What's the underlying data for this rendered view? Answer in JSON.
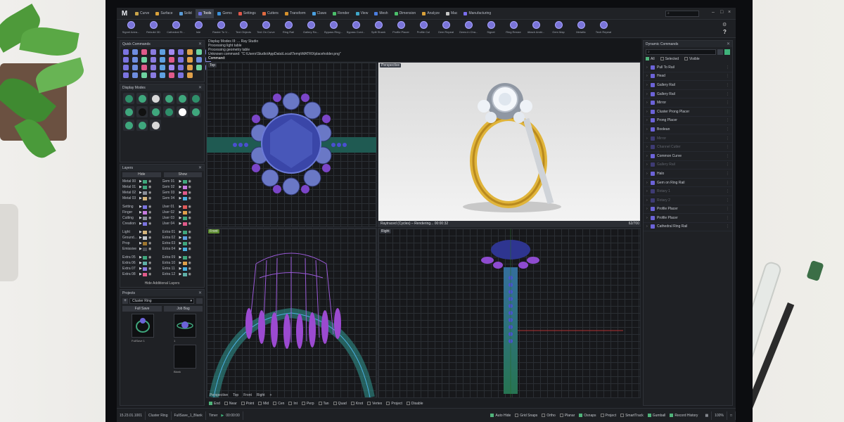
{
  "app": {
    "logo": "M",
    "menu_tabs": [
      {
        "label": "Curve",
        "color": "#c9a44a"
      },
      {
        "label": "Surface",
        "color": "#d9a13a"
      },
      {
        "label": "Solid",
        "color": "#5a9bd6"
      },
      {
        "label": "Tools",
        "color": "#6b6ee0",
        "active": true
      },
      {
        "label": "Gems",
        "color": "#3b8fd9"
      },
      {
        "label": "Settings",
        "color": "#e0584b"
      },
      {
        "label": "Cutters",
        "color": "#e06a40"
      },
      {
        "label": "Transform",
        "color": "#d6912c"
      },
      {
        "label": "Claws",
        "color": "#4aa0e0"
      },
      {
        "label": "Render",
        "color": "#4bbf6a"
      },
      {
        "label": "View",
        "color": "#3fa7c9"
      },
      {
        "label": "Mesh",
        "color": "#4b7ee0"
      },
      {
        "label": "Dimension",
        "color": "#4bbf6a"
      },
      {
        "label": "Analyze",
        "color": "#d9a13a"
      },
      {
        "label": "Mac",
        "color": "#c6c6c6"
      },
      {
        "label": "Manufacturing",
        "color": "#7b6ef0"
      }
    ],
    "search_placeholder": "⌕",
    "help_icon": "?",
    "ribbon": [
      "Signet Adva...",
      "Rebuild 3D",
      "Cathedral Ri...",
      "Isle",
      "Raster To V...",
      "Text Objects",
      "Text On Curve",
      "Ring Rail",
      "Gallery Ra...",
      "Bypass Ring...",
      "Bypass Curvi...",
      "Split Shank",
      "Profile Placer",
      "Profile Cut",
      "Gem Repeat",
      "Gems in Cha...",
      "Signet",
      "Ring Resize",
      "Attach Ambi...",
      "Gem Map",
      "Metallic",
      "Tech Repeat"
    ]
  },
  "quick_commands": {
    "title": "Quick Commands",
    "icon_colors": [
      "#7b74e0",
      "#6e8ee0",
      "#e05a8a",
      "#8a7be0",
      "#5fa0e0",
      "#a28af0",
      "#7b74e0",
      "#e0a04a",
      "#6ed3a0",
      "#8a8ae0",
      "#7b74e0",
      "#6e8ee0",
      "#6ed3a0",
      "#8a7be0",
      "#5fa0e0",
      "#e05a8a",
      "#7b74e0",
      "#e0a04a",
      "#6e8ee0",
      "#8a8ae0",
      "#7b74e0",
      "#6e8ee0",
      "#e05a8a",
      "#8a7be0",
      "#5fa0e0",
      "#a28af0",
      "#7b74e0",
      "#e0a04a",
      "#6ed3a0",
      "#8a8ae0",
      "#7b74e0",
      "#6e8ee0",
      "#6ed3a0",
      "#8a7be0",
      "#5fa0e0",
      "#e05a8a",
      "#7b74e0",
      "#e0a04a"
    ]
  },
  "display_modes": {
    "title": "Display Modes",
    "swatches": [
      "#2f8f6a",
      "#3fa77d",
      "#d8d8d8",
      "#3fa77d",
      "#3fa77d",
      "#2f8f6a",
      "#3fa77d",
      "#111",
      "#3fa77d",
      "#2f8f6a",
      "#ffffff",
      "#3fa77d",
      "#3fa77d",
      "#3fa77d",
      "#d8d8d8"
    ]
  },
  "layers": {
    "title": "Layers",
    "hide_label": "Hide",
    "show_label": "Show",
    "left": [
      [
        {
          "n": "Metal 00",
          "c": "#3fa77d"
        },
        {
          "n": "Metal 01",
          "c": "#3fa77d"
        },
        {
          "n": "Metal 02",
          "c": "#8a8f99"
        },
        {
          "n": "Metal 03",
          "c": "#d5b57c"
        }
      ],
      [
        {
          "n": "Setting",
          "c": "#7b74e0"
        },
        {
          "n": "Finger",
          "c": "#c77be0"
        },
        {
          "n": "Cutting",
          "c": "#8a8f99"
        },
        {
          "n": "Creation",
          "c": "#7b74e0"
        }
      ],
      [
        {
          "n": "Light",
          "c": "#d5b57c"
        },
        {
          "n": "Ground...",
          "c": "#c0c4ca"
        },
        {
          "n": "Prop",
          "c": "#a0772f"
        },
        {
          "n": "Emissive",
          "c": "#4a4d55"
        }
      ],
      [
        {
          "n": "Extra 05",
          "c": "#3fa77d"
        },
        {
          "n": "Extra 06",
          "c": "#5fb0a8"
        },
        {
          "n": "Extra 07",
          "c": "#8a7be0"
        },
        {
          "n": "Extra 08",
          "c": "#e05a8a"
        }
      ]
    ],
    "right": [
      [
        {
          "n": "Gem 01",
          "c": "#3fa77d"
        },
        {
          "n": "Gem 02",
          "c": "#c77be0"
        },
        {
          "n": "Gem 03",
          "c": "#e05a8a"
        },
        {
          "n": "Gem 04",
          "c": "#4ab0e0"
        }
      ],
      [
        {
          "n": "User 01",
          "c": "#e05a5a"
        },
        {
          "n": "User 02",
          "c": "#e0a04a"
        },
        {
          "n": "User 03",
          "c": "#3fa77d"
        },
        {
          "n": "User 04",
          "c": "#e05a8a"
        }
      ],
      [
        {
          "n": "Extra 01",
          "c": "#3fa77d"
        },
        {
          "n": "Extra 02",
          "c": "#5fa0e0"
        },
        {
          "n": "Extra 03",
          "c": "#3fa77d"
        },
        {
          "n": "Extra 04",
          "c": "#4ab0e0"
        }
      ],
      [
        {
          "n": "Extra 09",
          "c": "#3fa77d"
        },
        {
          "n": "Extra 10",
          "c": "#e0a04a"
        },
        {
          "n": "Extra 11",
          "c": "#4ab0e0"
        },
        {
          "n": "Extra 12",
          "c": "#5fb0a8"
        }
      ]
    ],
    "footer": "Hide Additional Layers"
  },
  "projects": {
    "title": "Projects",
    "project_name": "Cluster Ring",
    "full_save": "Full Save",
    "job_bag": "Job Bag",
    "thumbs": [
      {
        "label": "FullSave 1"
      },
      {
        "label": "1"
      },
      {
        "label": "Blank"
      }
    ]
  },
  "command_history": [
    "Display Modes III: ... Ray Studio",
    "Processing light table",
    "Processing geometry table",
    "Unknown command: \"C:\\Users\\Studio\\AppData\\Local\\Temp\\MATRIXplaceholder.png\""
  ],
  "command_prompt": "Command:",
  "viewports": {
    "top": "Top",
    "perspective": "Perspective",
    "front": "Front",
    "right": "Right",
    "render_status": "Raytraced (Cycles) – Rendering... 00:00:32",
    "render_counter": "62/700"
  },
  "view_tabs": [
    "Perspective",
    "Top",
    "Front",
    "Right",
    "+"
  ],
  "osnaps": [
    {
      "l": "End",
      "on": true
    },
    {
      "l": "Near",
      "on": false
    },
    {
      "l": "Point",
      "on": false
    },
    {
      "l": "Mid",
      "on": false
    },
    {
      "l": "Cen",
      "on": false
    },
    {
      "l": "Int",
      "on": false
    },
    {
      "l": "Perp",
      "on": false
    },
    {
      "l": "Tan",
      "on": false
    },
    {
      "l": "Quad",
      "on": false
    },
    {
      "l": "Knot",
      "on": false
    },
    {
      "l": "Vertex",
      "on": false
    },
    {
      "l": "Project",
      "on": false
    },
    {
      "l": "Disable",
      "on": false
    }
  ],
  "status": {
    "version": "15.23.01.1001",
    "project": "Cluster Ring",
    "file": "FullSave_1_Blank",
    "timer_label": "Timer",
    "timer": "00:00:00",
    "toggles": [
      {
        "l": "Auto Hide",
        "on": true
      },
      {
        "l": "Grid Snaps",
        "on": false
      },
      {
        "l": "Ortho",
        "on": false
      },
      {
        "l": "Planar",
        "on": false
      },
      {
        "l": "Osnaps",
        "on": true
      },
      {
        "l": "Project",
        "on": false
      },
      {
        "l": "SmartTrack",
        "on": false
      },
      {
        "l": "Gumball",
        "on": true
      },
      {
        "l": "Record History",
        "on": true
      }
    ],
    "zoom": "100%"
  },
  "dynamic_commands": {
    "title": "Dynamic Commands",
    "filters": [
      "All",
      "Selected",
      "Visible"
    ],
    "items": [
      {
        "l": "Pull To Rail",
        "dim": false
      },
      {
        "l": "Head",
        "dim": false
      },
      {
        "l": "Gallery Rail",
        "dim": false
      },
      {
        "l": "Gallery Rail",
        "dim": false
      },
      {
        "l": "Mirror",
        "dim": false
      },
      {
        "l": "Cluster Prong Placer",
        "dim": false
      },
      {
        "l": "Prong Placer",
        "dim": false
      },
      {
        "l": "Boolean",
        "dim": false
      },
      {
        "l": "Mirror",
        "dim": true
      },
      {
        "l": "Channel Cutter",
        "dim": true
      },
      {
        "l": "Common Curve",
        "dim": false
      },
      {
        "l": "Gallery Rail",
        "dim": true
      },
      {
        "l": "Halo",
        "dim": false
      },
      {
        "l": "Gem on Ring Rail",
        "dim": false
      },
      {
        "l": "Rotary 1",
        "dim": true
      },
      {
        "l": "Rotary 2",
        "dim": true
      },
      {
        "l": "Profile Placer",
        "dim": false
      },
      {
        "l": "Profile Placer",
        "dim": false
      },
      {
        "l": "Cathedral Ring Rail",
        "dim": false
      }
    ]
  }
}
